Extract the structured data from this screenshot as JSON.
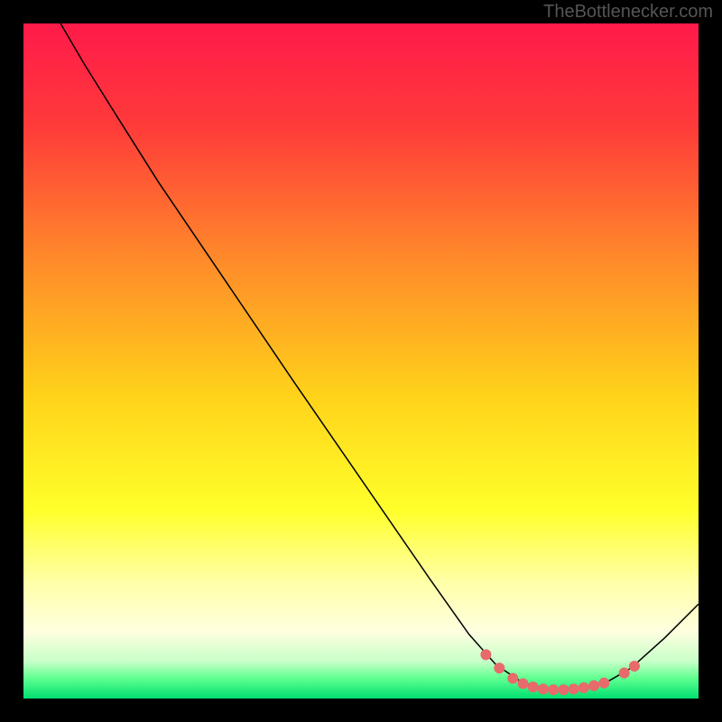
{
  "watermark": "TheBottlenecker.com",
  "chart_data": {
    "type": "line",
    "title": "",
    "xlabel": "",
    "ylabel": "",
    "xlim": [
      0,
      100
    ],
    "ylim": [
      0,
      100
    ],
    "grid": false,
    "background_gradient": {
      "stops": [
        {
          "offset": 0,
          "color": "#ff1a4a"
        },
        {
          "offset": 0.15,
          "color": "#ff3a3a"
        },
        {
          "offset": 0.35,
          "color": "#ff8a2a"
        },
        {
          "offset": 0.55,
          "color": "#ffd21a"
        },
        {
          "offset": 0.72,
          "color": "#ffff2a"
        },
        {
          "offset": 0.83,
          "color": "#ffffaa"
        },
        {
          "offset": 0.9,
          "color": "#ffffe0"
        },
        {
          "offset": 0.945,
          "color": "#c8ffc8"
        },
        {
          "offset": 0.97,
          "color": "#60ff90"
        },
        {
          "offset": 1.0,
          "color": "#00e070"
        }
      ]
    },
    "series": [
      {
        "name": "bottleneck-curve",
        "color": "#000000",
        "width": 1.5,
        "points": [
          {
            "x": 5.5,
            "y": 100
          },
          {
            "x": 9,
            "y": 94
          },
          {
            "x": 14,
            "y": 86
          },
          {
            "x": 20,
            "y": 76.5
          },
          {
            "x": 40,
            "y": 47
          },
          {
            "x": 60,
            "y": 18
          },
          {
            "x": 66,
            "y": 9.5
          },
          {
            "x": 70,
            "y": 5
          },
          {
            "x": 74,
            "y": 2.3
          },
          {
            "x": 78,
            "y": 1.3
          },
          {
            "x": 82,
            "y": 1.3
          },
          {
            "x": 86,
            "y": 2.2
          },
          {
            "x": 90,
            "y": 4.5
          },
          {
            "x": 95,
            "y": 9
          },
          {
            "x": 100,
            "y": 14
          }
        ]
      }
    ],
    "markers": {
      "color": "#e86a6a",
      "radius": 6,
      "points": [
        {
          "x": 68.5,
          "y": 6.5
        },
        {
          "x": 70.5,
          "y": 4.5
        },
        {
          "x": 72.5,
          "y": 3.0
        },
        {
          "x": 74.0,
          "y": 2.2
        },
        {
          "x": 75.5,
          "y": 1.7
        },
        {
          "x": 77.0,
          "y": 1.4
        },
        {
          "x": 78.5,
          "y": 1.3
        },
        {
          "x": 80.0,
          "y": 1.3
        },
        {
          "x": 81.5,
          "y": 1.4
        },
        {
          "x": 83.0,
          "y": 1.6
        },
        {
          "x": 84.5,
          "y": 1.9
        },
        {
          "x": 86.0,
          "y": 2.3
        },
        {
          "x": 89.0,
          "y": 3.8
        },
        {
          "x": 90.5,
          "y": 4.8
        }
      ]
    }
  }
}
